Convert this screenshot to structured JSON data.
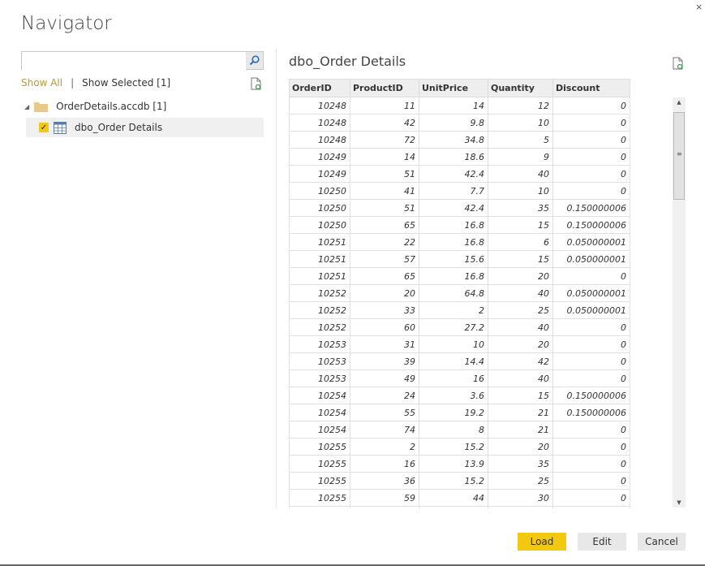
{
  "window": {
    "title": "Navigator",
    "close": "×"
  },
  "search": {
    "value": "",
    "placeholder": ""
  },
  "filters": {
    "show_all": "Show All",
    "separator": "|",
    "show_selected": "Show Selected [1]"
  },
  "tree": {
    "folder": "OrderDetails.accdb [1]",
    "item": "dbo_Order Details",
    "item_checked": true
  },
  "preview": {
    "title": "dbo_Order Details",
    "columns": [
      "OrderID",
      "ProductID",
      "UnitPrice",
      "Quantity",
      "Discount"
    ],
    "rows": [
      [
        "10248",
        "11",
        "14",
        "12",
        "0"
      ],
      [
        "10248",
        "42",
        "9.8",
        "10",
        "0"
      ],
      [
        "10248",
        "72",
        "34.8",
        "5",
        "0"
      ],
      [
        "10249",
        "14",
        "18.6",
        "9",
        "0"
      ],
      [
        "10249",
        "51",
        "42.4",
        "40",
        "0"
      ],
      [
        "10250",
        "41",
        "7.7",
        "10",
        "0"
      ],
      [
        "10250",
        "51",
        "42.4",
        "35",
        "0.150000006"
      ],
      [
        "10250",
        "65",
        "16.8",
        "15",
        "0.150000006"
      ],
      [
        "10251",
        "22",
        "16.8",
        "6",
        "0.050000001"
      ],
      [
        "10251",
        "57",
        "15.6",
        "15",
        "0.050000001"
      ],
      [
        "10251",
        "65",
        "16.8",
        "20",
        "0"
      ],
      [
        "10252",
        "20",
        "64.8",
        "40",
        "0.050000001"
      ],
      [
        "10252",
        "33",
        "2",
        "25",
        "0.050000001"
      ],
      [
        "10252",
        "60",
        "27.2",
        "40",
        "0"
      ],
      [
        "10253",
        "31",
        "10",
        "20",
        "0"
      ],
      [
        "10253",
        "39",
        "14.4",
        "42",
        "0"
      ],
      [
        "10253",
        "49",
        "16",
        "40",
        "0"
      ],
      [
        "10254",
        "24",
        "3.6",
        "15",
        "0.150000006"
      ],
      [
        "10254",
        "55",
        "19.2",
        "21",
        "0.150000006"
      ],
      [
        "10254",
        "74",
        "8",
        "21",
        "0"
      ],
      [
        "10255",
        "2",
        "15.2",
        "20",
        "0"
      ],
      [
        "10255",
        "16",
        "13.9",
        "35",
        "0"
      ],
      [
        "10255",
        "36",
        "15.2",
        "25",
        "0"
      ],
      [
        "10255",
        "59",
        "44",
        "30",
        "0"
      ],
      [
        "",
        "",
        "",
        "",
        ""
      ]
    ]
  },
  "buttons": {
    "load": "Load",
    "edit": "Edit",
    "cancel": "Cancel"
  },
  "colors": {
    "accent": "#f2c811",
    "link": "#b99a3b"
  }
}
